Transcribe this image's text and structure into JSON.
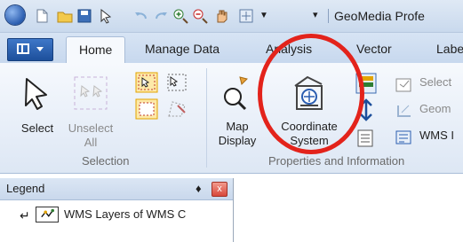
{
  "app": {
    "title": "GeoMedia Profe"
  },
  "tabs": [
    {
      "label": "Home",
      "active": true
    },
    {
      "label": "Manage Data"
    },
    {
      "label": "Analysis"
    },
    {
      "label": "Vector"
    },
    {
      "label": "Labe"
    }
  ],
  "ribbon": {
    "selection_group": {
      "label": "Selection",
      "select": "Select",
      "unselect_line1": "Unselect",
      "unselect_line2": "All"
    },
    "properties_group": {
      "label": "Properties and Information",
      "map_display_line1": "Map",
      "map_display_line2": "Display",
      "coordinate_system_line1": "Coordinate",
      "coordinate_system_line2": "System",
      "select_set": "Select",
      "geometry": "Geom",
      "wms": "WMS I"
    }
  },
  "legend": {
    "title": "Legend",
    "pin": "☧",
    "close": "x",
    "items": [
      {
        "label": "WMS Layers of WMS C"
      }
    ]
  },
  "colors": {
    "accent": "#2a5db0",
    "highlight_circle": "#e3231b"
  }
}
